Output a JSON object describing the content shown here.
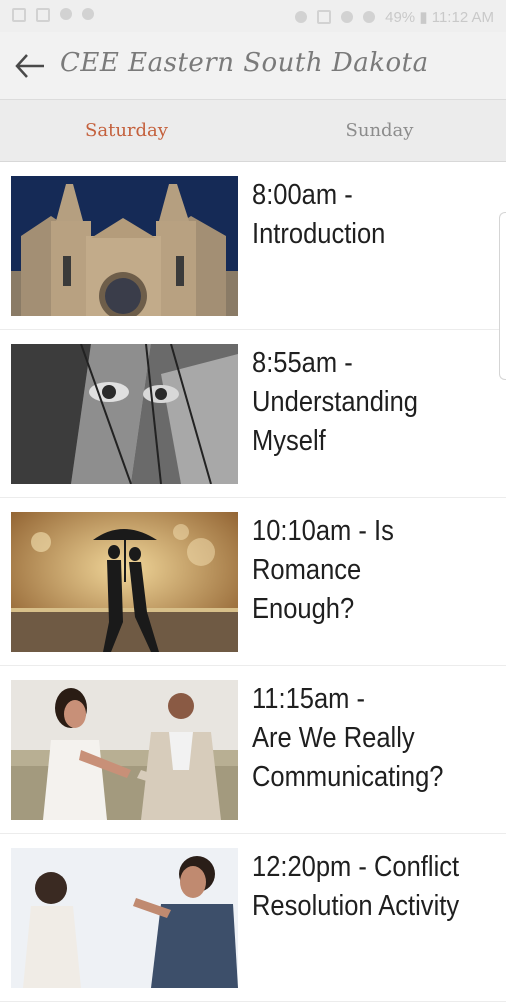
{
  "status_bar": {
    "right_text": "49% ▮ 11:12 AM"
  },
  "app_bar": {
    "title": "CEE Eastern South Dakota"
  },
  "tabs": [
    {
      "label": "Saturday",
      "active": true
    },
    {
      "label": "Sunday",
      "active": false
    }
  ],
  "sessions": [
    {
      "title": "8:00am -\nIntroduction",
      "image": "cathedral-photo"
    },
    {
      "title": "8:55am -\nUnderstanding\nMyself",
      "image": "mirror-face-photo"
    },
    {
      "title": "10:10am - Is\nRomance Enough?",
      "image": "couple-umbrella-photo"
    },
    {
      "title": "11:15am -\nAre We Really\nCommunicating?",
      "image": "couple-couch-photo"
    },
    {
      "title": "12:20pm - Conflict\nResolution Activity",
      "image": "conflict-photo"
    }
  ],
  "colors": {
    "accent": "#c4603c",
    "tab_inactive": "#8c8c8c",
    "app_bar_bg": "#f2f2f2",
    "tabs_bg": "#ececec"
  }
}
